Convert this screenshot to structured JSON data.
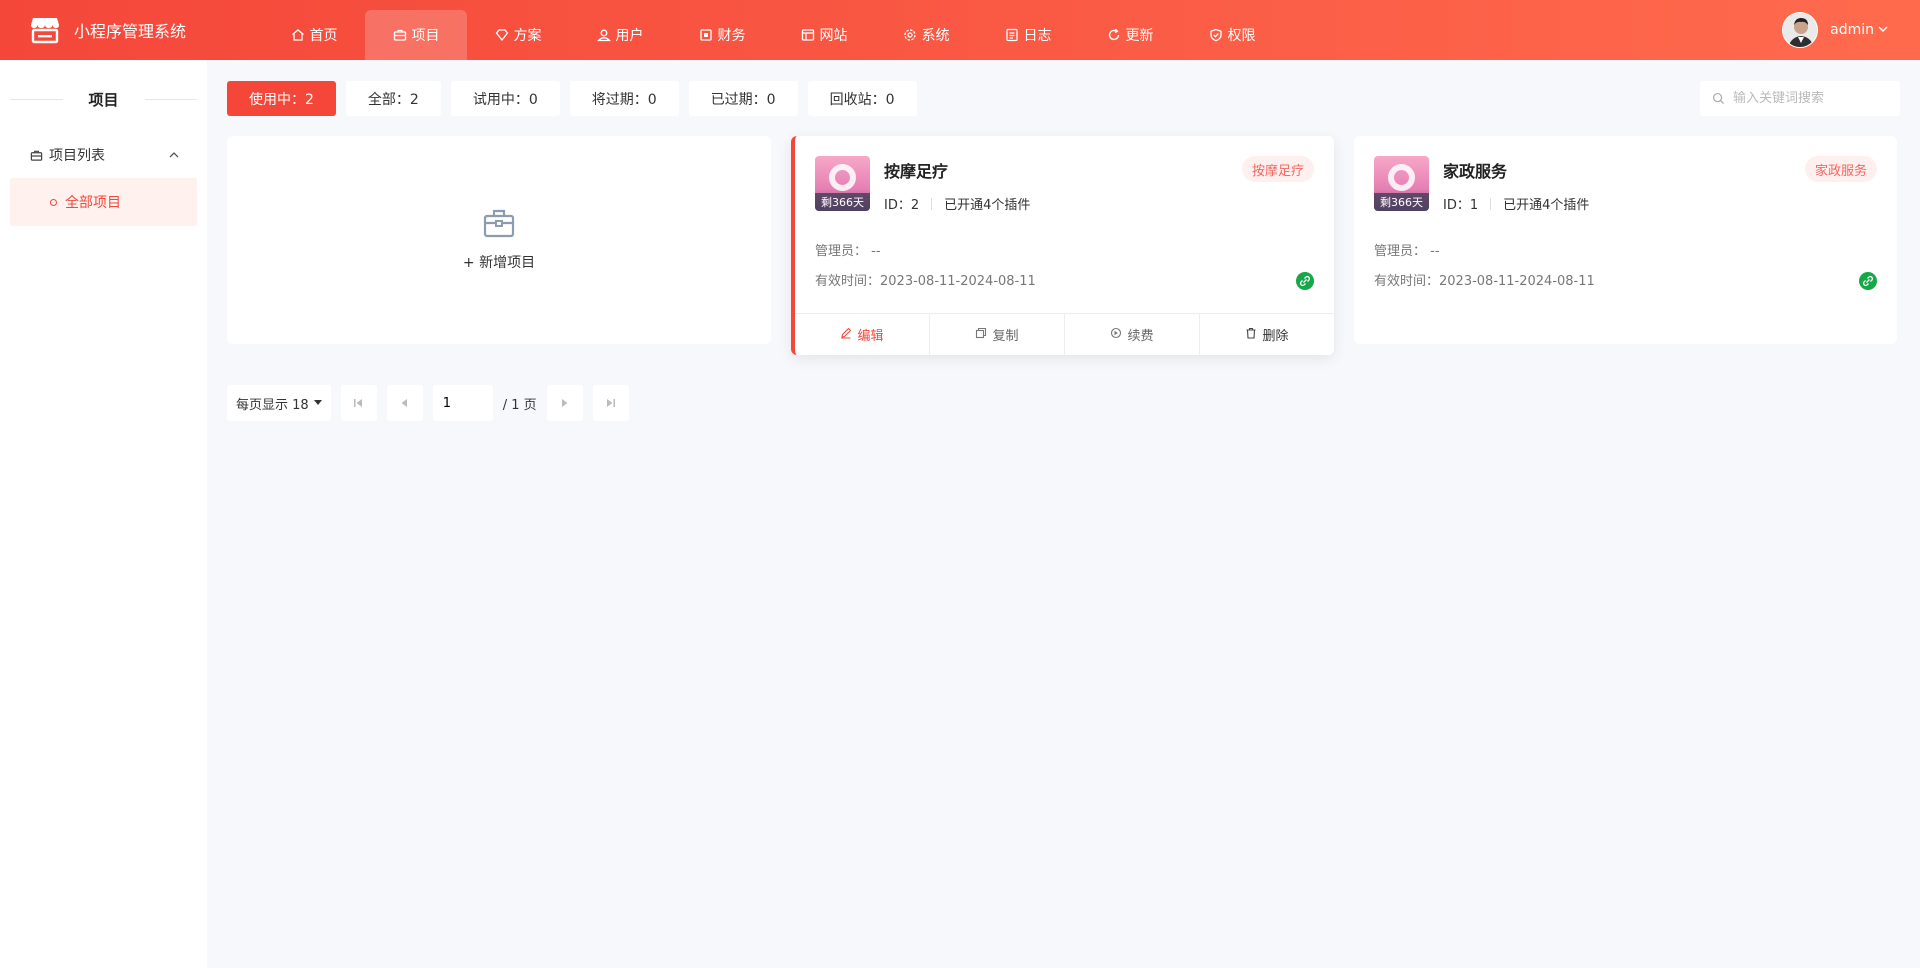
{
  "header": {
    "title": "小程序管理系统",
    "nav": [
      {
        "label": "首页",
        "icon": "home-icon"
      },
      {
        "label": "项目",
        "icon": "briefcase-icon",
        "active": true
      },
      {
        "label": "方案",
        "icon": "diamond-icon"
      },
      {
        "label": "用户",
        "icon": "user-icon"
      },
      {
        "label": "财务",
        "icon": "finance-icon"
      },
      {
        "label": "网站",
        "icon": "website-icon"
      },
      {
        "label": "系统",
        "icon": "gear-icon"
      },
      {
        "label": "日志",
        "icon": "log-icon"
      },
      {
        "label": "更新",
        "icon": "refresh-icon"
      },
      {
        "label": "权限",
        "icon": "shield-icon"
      }
    ],
    "user": {
      "name": "admin"
    }
  },
  "sidebar": {
    "heading": "项目",
    "group": {
      "label": "项目列表"
    },
    "items": [
      {
        "label": "全部项目"
      }
    ]
  },
  "filters": [
    {
      "label": "使用中：2",
      "active": true
    },
    {
      "label": "全部：2"
    },
    {
      "label": "试用中：0"
    },
    {
      "label": "将过期：0"
    },
    {
      "label": "已过期：0"
    },
    {
      "label": "回收站：0"
    }
  ],
  "search": {
    "placeholder": "输入关键词搜索"
  },
  "add_card": {
    "label": "+ 新增项目"
  },
  "projects": [
    {
      "name": "按摩足疗",
      "days": "剩366天",
      "id_text": "ID：2",
      "plugins": "已开通4个插件",
      "tag": "按摩足疗",
      "manager": "管理员： --",
      "valid": "有效时间：2023-08-11-2024-08-11"
    },
    {
      "name": "家政服务",
      "days": "剩366天",
      "id_text": "ID：1",
      "plugins": "已开通4个插件",
      "tag": "家政服务",
      "manager": "管理员： --",
      "valid": "有效时间：2023-08-11-2024-08-11"
    }
  ],
  "actions": {
    "edit": "编辑",
    "copy": "复制",
    "renew": "续费",
    "delete": "删除"
  },
  "pager": {
    "per_page": "每页显示 18",
    "page": "1",
    "total": "/ 1 页"
  },
  "colors": {
    "accent": "#f4473a",
    "tag_bg": "#fff0f0",
    "link_green": "#15a846"
  }
}
